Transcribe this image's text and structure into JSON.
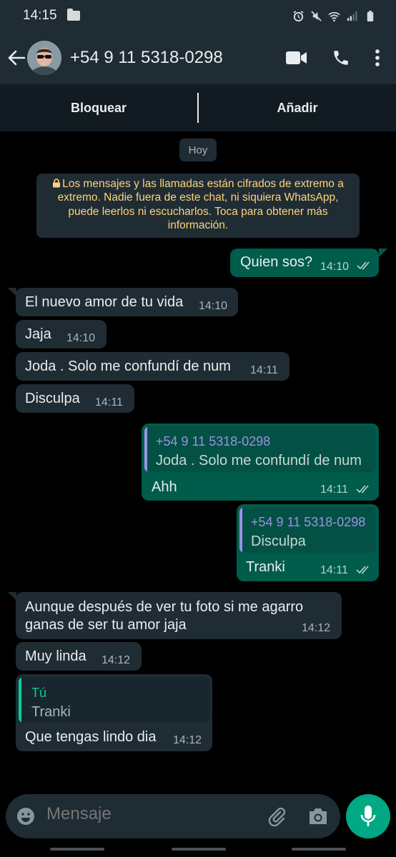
{
  "status_bar": {
    "time": "14:15"
  },
  "header": {
    "contact": "+54 9 11 5318-0298"
  },
  "action_bar": {
    "block": "Bloquear",
    "add": "Añadir"
  },
  "date_chip": "Hoy",
  "encryption_notice": "Los mensajes y las llamadas están cifrados de extremo a extremo. Nadie fuera de este chat, ni siquiera WhatsApp, puede leerlos ni escucharlos. Toca para obtener más información.",
  "messages": [
    {
      "dir": "out",
      "text": "Quien sos?",
      "time": "14:10"
    },
    {
      "dir": "in",
      "text": "El nuevo amor de tu vida",
      "time": "14:10"
    },
    {
      "dir": "in",
      "text": "Jaja",
      "time": "14:10"
    },
    {
      "dir": "in",
      "text": "Joda . Solo me confundí de num",
      "time": "14:11"
    },
    {
      "dir": "in",
      "text": "Disculpa",
      "time": "14:11"
    },
    {
      "dir": "out",
      "quote_name": "+54 9 11 5318-0298",
      "quote_text": "Joda . Solo me confundí de num",
      "text": "Ahh",
      "time": "14:11"
    },
    {
      "dir": "out",
      "quote_name": "+54 9 11 5318-0298",
      "quote_text": "Disculpa",
      "text": "Tranki",
      "time": "14:11"
    },
    {
      "dir": "in",
      "line1": "Aunque después de ver tu foto si me agarro",
      "line2": "ganas de ser tu amor jaja",
      "time": "14:12"
    },
    {
      "dir": "in",
      "text": "Muy linda",
      "time": "14:12"
    },
    {
      "dir": "in",
      "quote_name": "Tú",
      "quote_text": "Tranki",
      "text": "Que tengas lindo dia",
      "time": "14:12"
    }
  ],
  "composer": {
    "placeholder": "Mensaje"
  },
  "colors": {
    "accent": "#00a884",
    "incoming": "#1f2c34",
    "outgoing": "#005c4b",
    "notice_text": "#ffd279",
    "quote_name_out": "#9f8fe6",
    "quote_name_in": "#06cf9c"
  }
}
